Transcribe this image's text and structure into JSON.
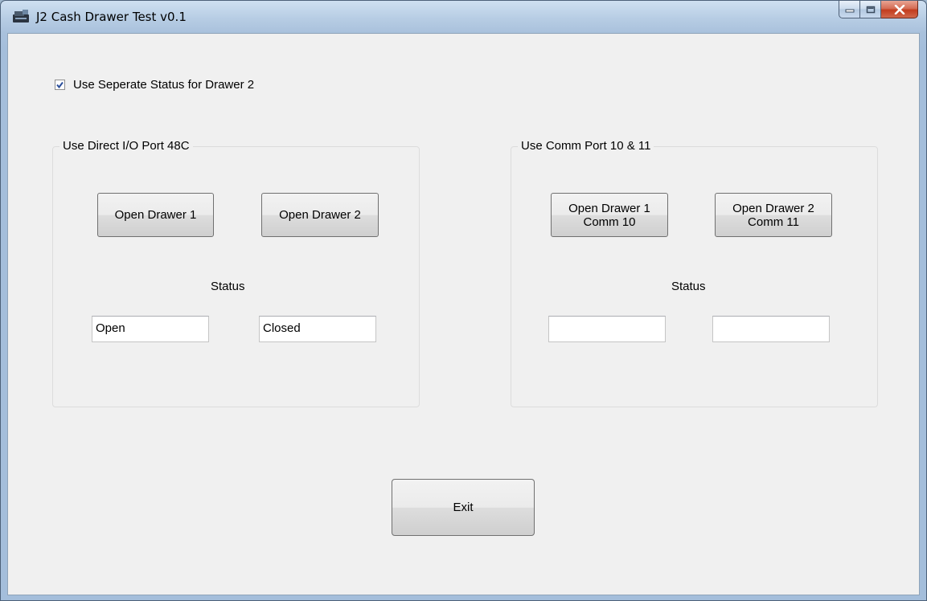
{
  "window": {
    "title": "J2 Cash Drawer Test v0.1"
  },
  "options": {
    "separate_status_label": "Use Seperate Status for Drawer 2",
    "separate_status_checked": true
  },
  "group_direct": {
    "legend": "Use Direct I/O  Port 48C",
    "open_drawer_1": "Open Drawer 1",
    "open_drawer_2": "Open Drawer 2",
    "status_label": "Status",
    "status_1": "Open",
    "status_2": "Closed"
  },
  "group_comm": {
    "legend": "Use Comm Port 10 & 11",
    "open_drawer_1": "Open Drawer 1\nComm 10",
    "open_drawer_2": "Open Drawer 2\nComm 11",
    "status_label": "Status",
    "status_1": "",
    "status_2": ""
  },
  "footer": {
    "exit_label": "Exit"
  },
  "icons": {
    "app": "cash-drawer-icon",
    "minimize": "minimize-icon",
    "maximize": "maximize-icon",
    "close": "close-icon",
    "check": "checkmark-icon"
  }
}
